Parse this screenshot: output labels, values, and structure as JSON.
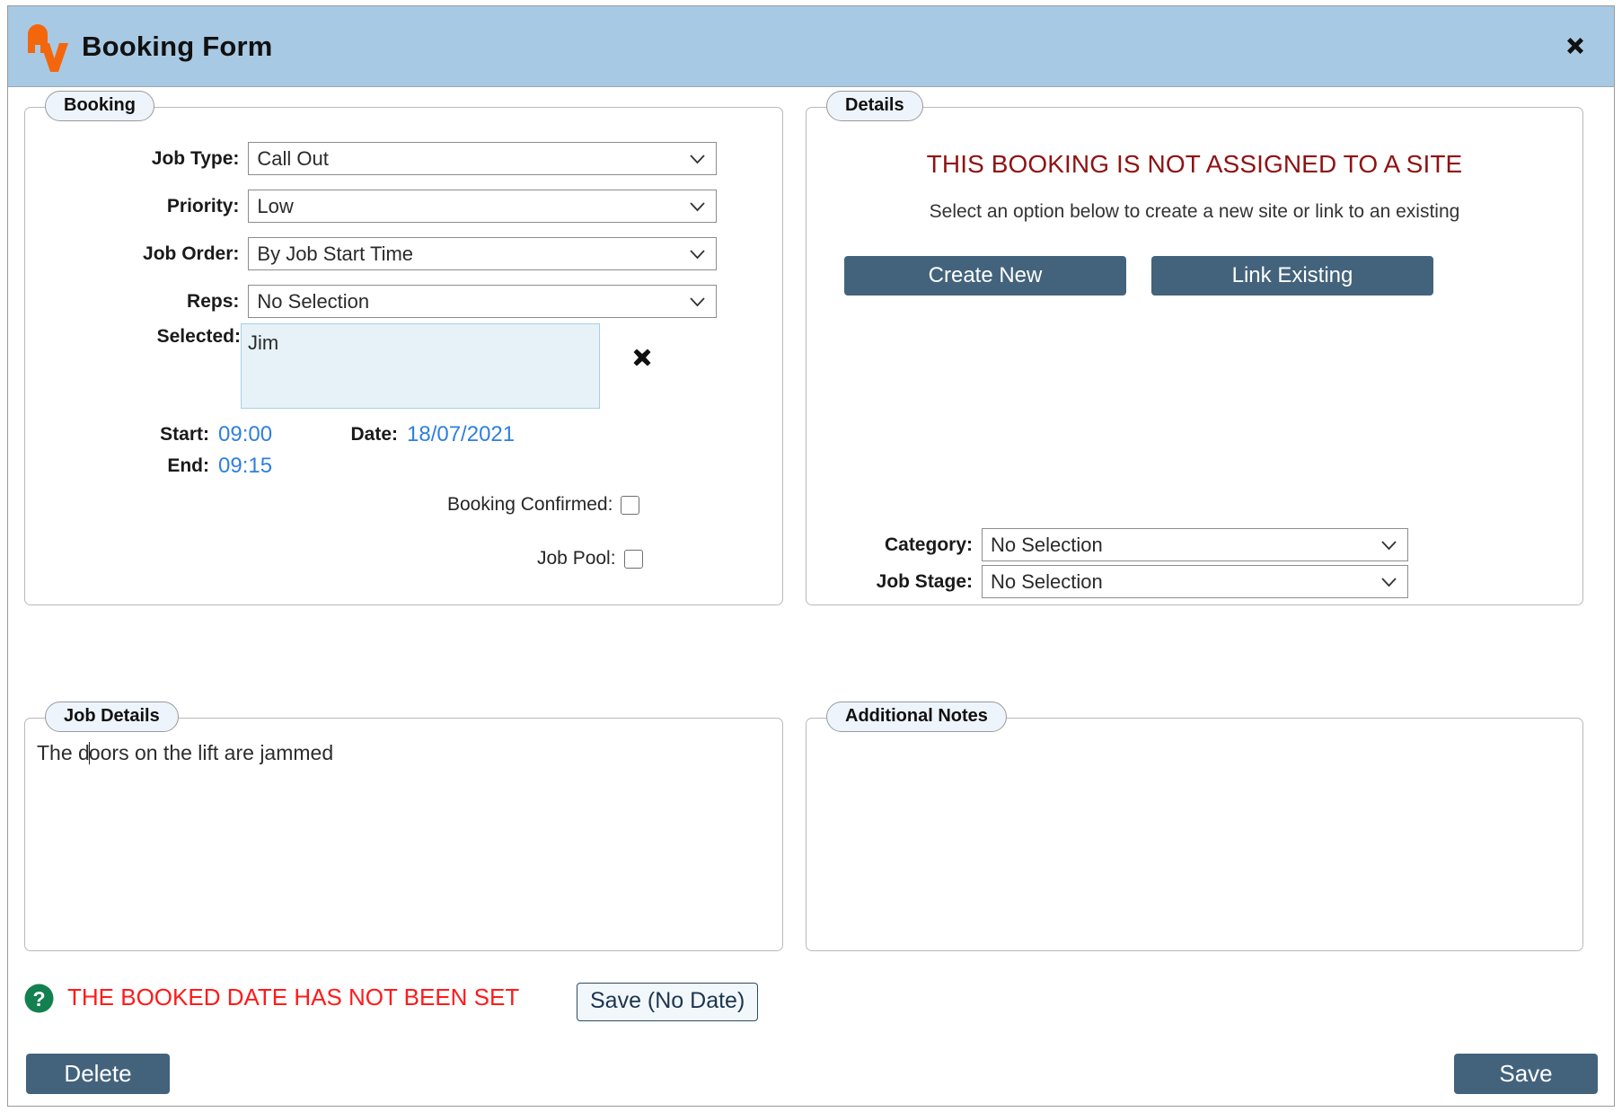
{
  "window": {
    "title": "Booking Form",
    "logo_icon": "av-logo-icon",
    "close_icon": "close-icon"
  },
  "booking": {
    "legend": "Booking",
    "fields": [
      {
        "label": "Job Type:",
        "value": "Call Out"
      },
      {
        "label": "Priority:",
        "value": "Low"
      },
      {
        "label": "Job Order:",
        "value": "By Job Start Time"
      },
      {
        "label": "Reps:",
        "value": "No Selection"
      }
    ],
    "selected_label": "Selected:",
    "selected_value": "Jim",
    "clear_icon": "clear-x-icon",
    "start_label": "Start:",
    "start_value": "09:00",
    "end_label": "End:",
    "end_value": "09:15",
    "date_label": "Date:",
    "date_value": "18/07/2021",
    "checkboxes": [
      {
        "label": "Booking Confirmed:",
        "checked": false
      },
      {
        "label": "Job Pool:",
        "checked": false
      }
    ]
  },
  "details": {
    "legend": "Details",
    "warning": "THIS BOOKING IS NOT ASSIGNED TO A SITE",
    "subtitle": "Select an option below to create a new site or link to an existing",
    "create_new_label": "Create New",
    "link_existing_label": "Link Existing",
    "category_label": "Category:",
    "category_value": "No Selection",
    "job_stage_label": "Job Stage:",
    "job_stage_value": "No Selection"
  },
  "job_details": {
    "legend": "Job Details",
    "text_before_caret": "The d",
    "text_after_caret": "oors on the lift are jammed"
  },
  "additional_notes": {
    "legend": "Additional Notes",
    "text": ""
  },
  "footer": {
    "help_icon": "help-question-icon",
    "warning": "THE BOOKED DATE HAS NOT BEEN SET",
    "save_no_date_label": "Save (No Date)",
    "delete_label": "Delete",
    "save_label": "Save"
  },
  "colors": {
    "titlebar": "#a8c9e4",
    "logo_orange": "#f4660c",
    "accent_button": "#43637c",
    "warning_dark_red": "#8f1212",
    "warning_red": "#ff1a1a",
    "link_blue": "#2f7fe0",
    "help_green": "#138050",
    "legend_fill": "#eef4fb",
    "selected_fill": "#e6f2f8"
  }
}
